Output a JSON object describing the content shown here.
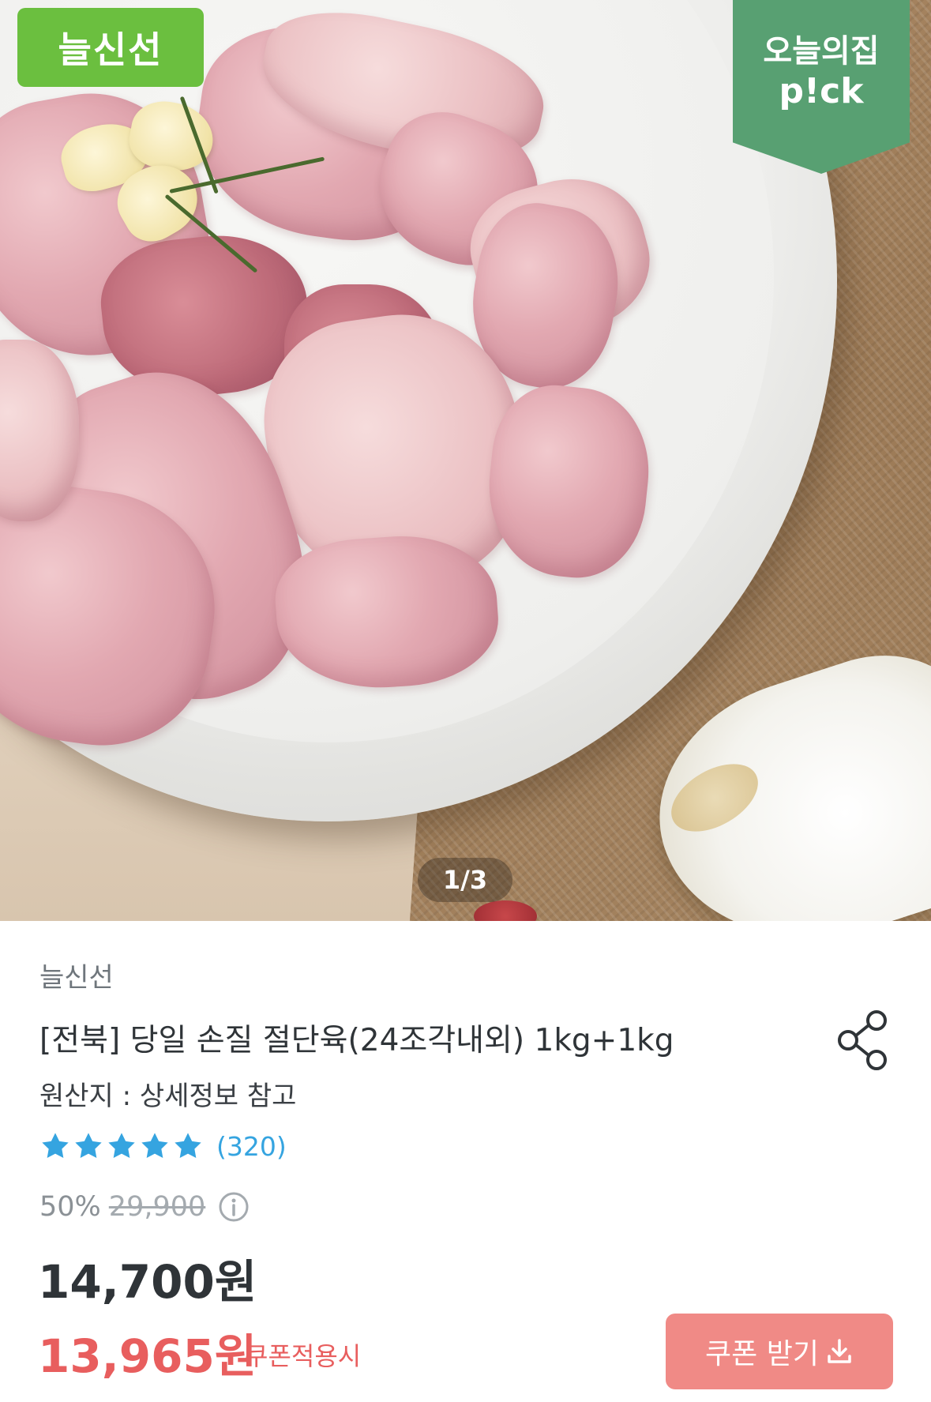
{
  "hero": {
    "brand_badge": "늘신선",
    "pick_badge_line1": "오늘의집",
    "pick_badge_line2": "p!ck",
    "pager": "1/3"
  },
  "product": {
    "brand": "늘신선",
    "title": "[전북] 당일 손질 절단육(24조각내외) 1kg+1kg",
    "origin": "원산지 : 상세정보 참고",
    "rating_stars": 5,
    "review_count": "(320)",
    "discount_rate": "50%",
    "original_price": "29,900",
    "price": "14,700원",
    "coupon_price": "13,965원",
    "coupon_note": "쿠폰적용시",
    "coupon_button": "쿠폰 받기"
  },
  "colors": {
    "brand_badge": "#6bbf3f",
    "pick_badge": "#58a072",
    "star": "#35a4e0",
    "coupon": "#e85e5e",
    "coupon_button": "#f08a86"
  },
  "icons": {
    "share": "share-icon",
    "info": "info-icon",
    "download": "download-icon",
    "star": "star-icon"
  }
}
